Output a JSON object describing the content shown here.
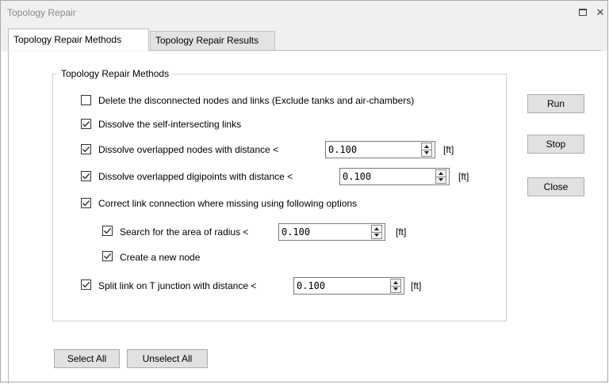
{
  "window": {
    "title": "Topology Repair",
    "restore_icon": "restore-icon",
    "close_glyph": "✕"
  },
  "tabs": [
    {
      "label": "Topology Repair Methods",
      "active": true
    },
    {
      "label": "Topology Repair Results",
      "active": false
    }
  ],
  "group": {
    "title": "Topology Repair Methods"
  },
  "options": {
    "delete_disconnected": {
      "label": "Delete the disconnected nodes and links (Exclude tanks and air-chambers)",
      "checked": false
    },
    "dissolve_self_intersecting": {
      "label": "Dissolve the self-intersecting links",
      "checked": true
    },
    "dissolve_overlapped_nodes": {
      "label": "Dissolve overlapped nodes with distance <",
      "checked": true,
      "value": "0.100",
      "unit": "[ft]"
    },
    "dissolve_overlapped_digipoints": {
      "label": "Dissolve overlapped digipoints with distance <",
      "checked": true,
      "value": "0.100",
      "unit": "[ft]"
    },
    "correct_link_connection": {
      "label": "Correct link connection where missing using following options",
      "checked": true
    },
    "search_radius": {
      "label": "Search for the area of radius <",
      "checked": true,
      "value": "0.100",
      "unit": "[ft]"
    },
    "create_new_node": {
      "label": "Create a new node",
      "checked": true
    },
    "split_link": {
      "label": "Split link on T junction with distance <",
      "checked": true,
      "value": "0.100",
      "unit": "[ft]"
    }
  },
  "buttons": {
    "run": "Run",
    "stop": "Stop",
    "close": "Close",
    "select_all": "Select All",
    "unselect_all": "Unselect All"
  }
}
